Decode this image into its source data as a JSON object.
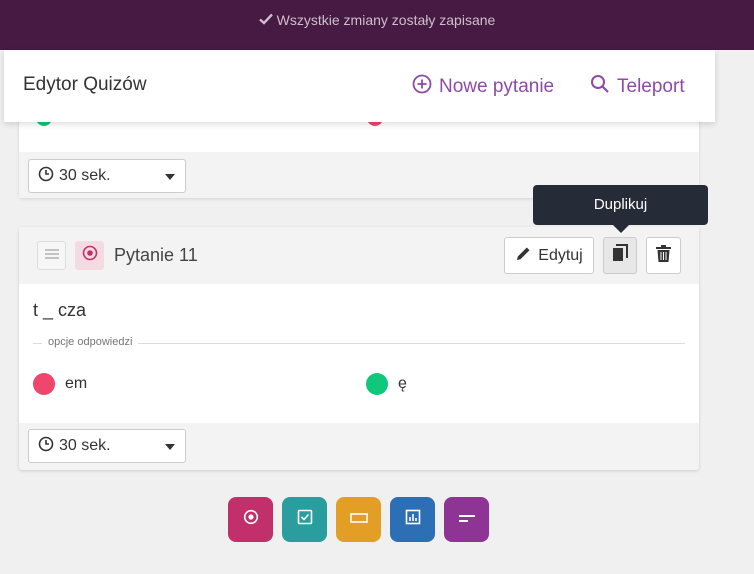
{
  "status": {
    "text": "Wszystkie zmiany zostały zapisane",
    "icon": "check-icon"
  },
  "header": {
    "title": "Edytor Quizów",
    "new_question": "Nowe pytanie",
    "teleport": "Teleport",
    "accent": "#8d4aa8"
  },
  "previous_question": {
    "answer_colors": [
      "#0fc87c",
      "#f0466e"
    ],
    "timer": "30 sek."
  },
  "question": {
    "label": "Pytanie 11",
    "text": "t _ cza",
    "edit_label": "Edytuj",
    "options_label": "opcje odpowiedzi",
    "answers": [
      {
        "text": "em",
        "color": "#f0466e"
      },
      {
        "text": "ę",
        "color": "#0fc87c"
      }
    ],
    "timer": "30 sek."
  },
  "tooltip": {
    "text": "Duplikuj"
  },
  "add_buttons": [
    {
      "name": "single-choice",
      "color": "#c2306b"
    },
    {
      "name": "multiple-choice",
      "color": "#2a9d9f"
    },
    {
      "name": "open-text",
      "color": "#e39f25"
    },
    {
      "name": "poll",
      "color": "#2c6fb5"
    },
    {
      "name": "fill-blank",
      "color": "#8e3494"
    }
  ]
}
